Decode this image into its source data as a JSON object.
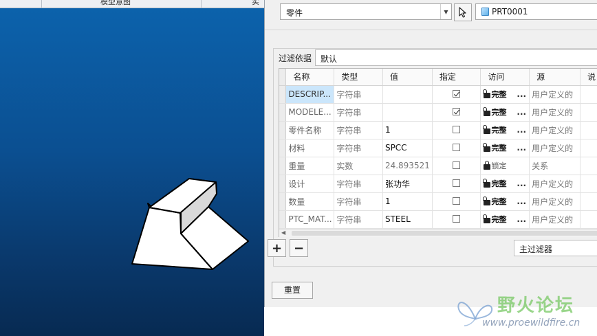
{
  "viewport": {
    "header": {
      "col1": "模型意图",
      "col2": "实"
    },
    "background_color": "#0b4f91"
  },
  "top_bar": {
    "type_select": "零件",
    "pick_icon": "cursor-arrow-icon",
    "part_icon": "part-cube-icon",
    "part_name": "PRT0001"
  },
  "filter": {
    "label": "过滤依据",
    "value": "默认"
  },
  "table": {
    "columns": [
      "名称",
      "类型",
      "值",
      "指定",
      "访问",
      "源",
      "说"
    ],
    "rows": [
      {
        "name": "DESCRIP...",
        "type": "字符串",
        "value": "",
        "designated": true,
        "access": "完整",
        "source": "用户定义的"
      },
      {
        "name": "MODELE...",
        "type": "字符串",
        "value": "",
        "designated": true,
        "access": "完整",
        "source": "用户定义的"
      },
      {
        "name": "零件名称",
        "type": "字符串",
        "value": "1",
        "designated": false,
        "access": "完整",
        "source": "用户定义的"
      },
      {
        "name": "材料",
        "type": "字符串",
        "value": "SPCC",
        "designated": false,
        "access": "完整",
        "source": "用户定义的"
      },
      {
        "name": "重量",
        "type": "实数",
        "value": "24.893521",
        "designated": false,
        "access": "锁定",
        "source": "关系"
      },
      {
        "name": "设计",
        "type": "字符串",
        "value": "张功华",
        "designated": false,
        "access": "完整",
        "source": "用户定义的"
      },
      {
        "name": "数量",
        "type": "字符串",
        "value": "1",
        "designated": false,
        "access": "完整",
        "source": "用户定义的"
      },
      {
        "name": "PTC_MAT...",
        "type": "字符串",
        "value": "STEEL",
        "designated": false,
        "access": "完整",
        "source": "用户定义的"
      }
    ]
  },
  "buttons": {
    "add": "+",
    "remove": "−",
    "main_filter": "主过滤器",
    "reset": "重置"
  },
  "watermark": {
    "title": "野火论坛",
    "url": "www.proewildfire.cn"
  }
}
